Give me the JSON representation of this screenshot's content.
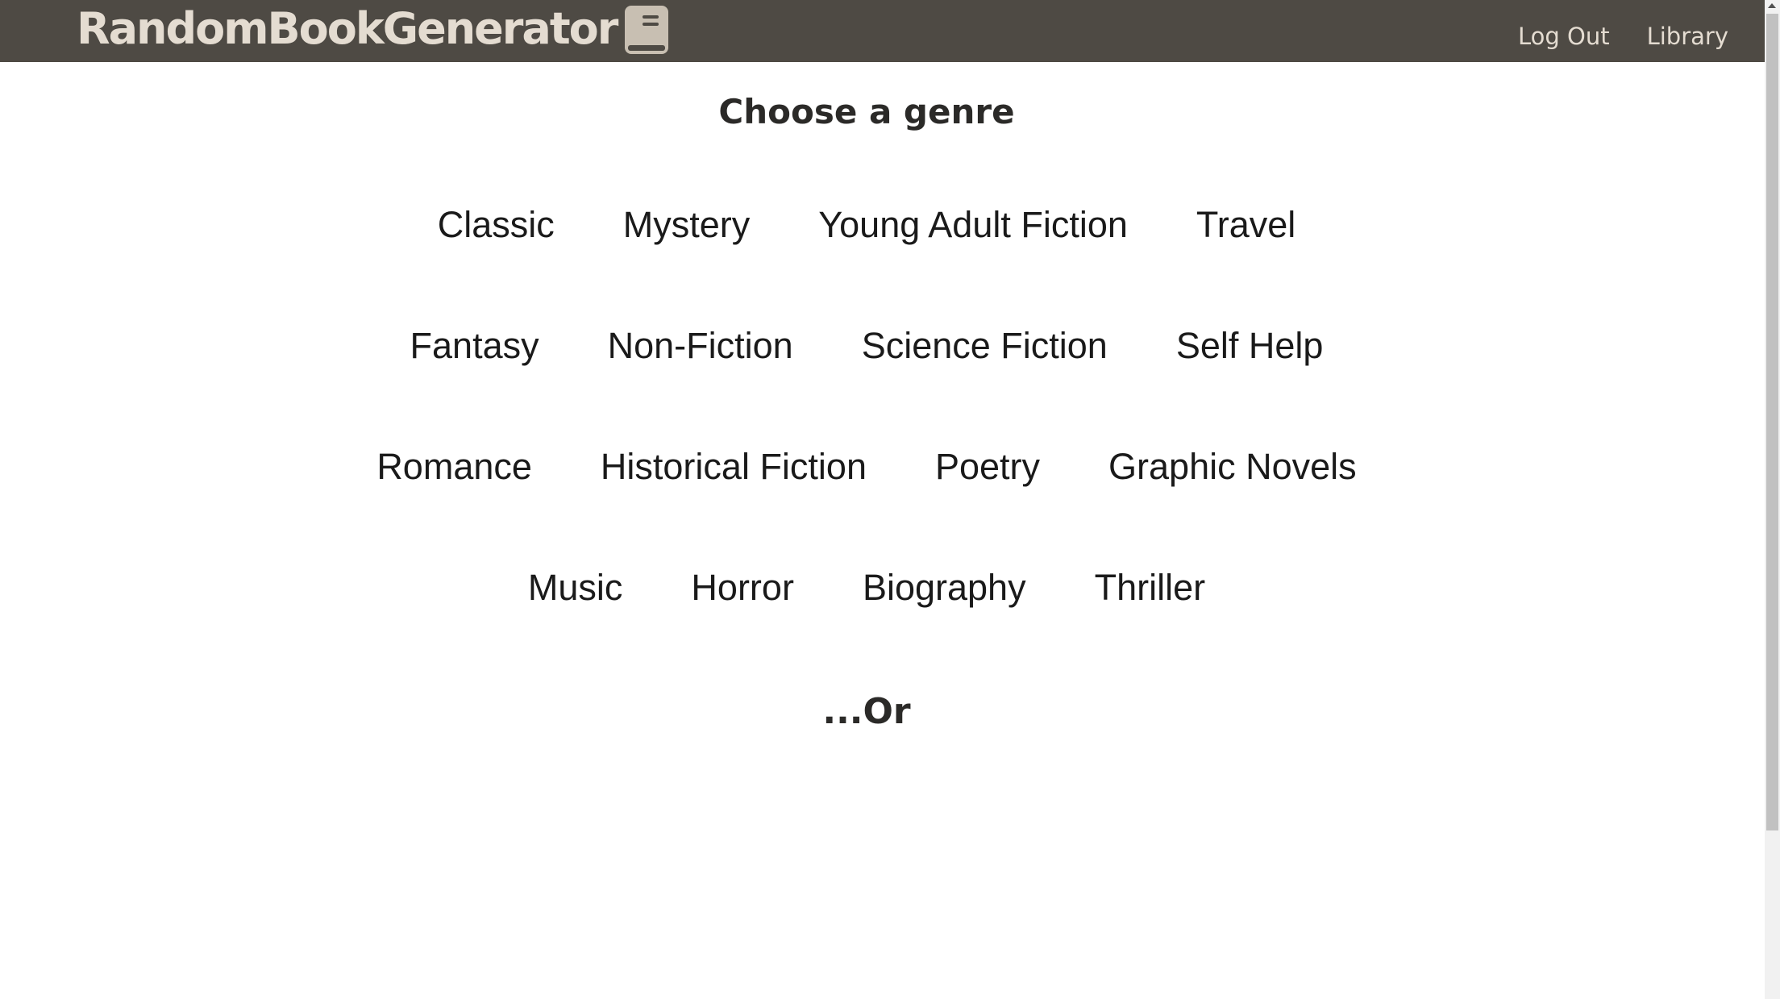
{
  "header": {
    "brand_name": "RandomBookGenerator",
    "brand_icon": "book-icon",
    "nav": [
      {
        "label": "Log Out"
      },
      {
        "label": "Library"
      }
    ]
  },
  "main": {
    "heading": "Choose a genre",
    "genre_rows": [
      [
        "Classic",
        "Mystery",
        "Young Adult Fiction",
        "Travel"
      ],
      [
        "Fantasy",
        "Non-Fiction",
        "Science Fiction",
        "Self Help"
      ],
      [
        "Romance",
        "Historical Fiction",
        "Poetry",
        "Graphic Novels"
      ],
      [
        "Music",
        "Horror",
        "Biography",
        "Thriller"
      ]
    ],
    "or_text": "...Or"
  },
  "colors": {
    "navbar_bg": "#4e4a44",
    "navbar_text": "#e4dcd1",
    "page_bg": "#ffffff",
    "heading_text": "#2b2a28"
  }
}
